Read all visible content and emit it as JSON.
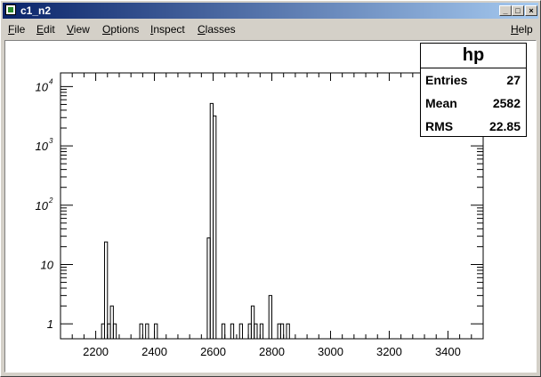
{
  "window": {
    "title": "c1_n2",
    "buttons": [
      "_",
      "□",
      "×"
    ]
  },
  "menubar": {
    "items": [
      {
        "label": "File",
        "mnemonic": "F",
        "rest": "ile"
      },
      {
        "label": "Edit",
        "mnemonic": "E",
        "rest": "dit"
      },
      {
        "label": "View",
        "mnemonic": "V",
        "rest": "iew"
      },
      {
        "label": "Options",
        "mnemonic": "O",
        "rest": "ptions"
      },
      {
        "label": "Inspect",
        "mnemonic": "I",
        "rest": "nspect"
      },
      {
        "label": "Classes",
        "mnemonic": "C",
        "rest": "lasses"
      }
    ],
    "help": {
      "label": "Help",
      "mnemonic": "H",
      "rest": "elp"
    }
  },
  "statbox": {
    "name": "hp",
    "entries_label": "Entries",
    "entries_value": "27",
    "mean_label": "Mean",
    "mean_value": "2582",
    "rms_label": "RMS",
    "rms_value": "22.85"
  },
  "chart_data": {
    "type": "bar",
    "title": "",
    "xlabel": "",
    "ylabel": "",
    "log_y": true,
    "xlim": [
      2080,
      3520
    ],
    "ylim": [
      0.56,
      17000
    ],
    "x_ticks": [
      2200,
      2400,
      2600,
      2800,
      3000,
      3200,
      3400
    ],
    "y_ticks": [
      {
        "value": 1,
        "label": "1"
      },
      {
        "value": 10,
        "label": "10"
      },
      {
        "value": 100,
        "label": "10",
        "exp": "2"
      },
      {
        "value": 1000,
        "label": "10",
        "exp": "3"
      },
      {
        "value": 10000,
        "label": "10",
        "exp": "4"
      }
    ],
    "bin_width": 10,
    "bins": [
      {
        "x": 2220,
        "value": 1
      },
      {
        "x": 2230,
        "value": 24
      },
      {
        "x": 2240,
        "value": 1
      },
      {
        "x": 2250,
        "value": 2
      },
      {
        "x": 2260,
        "value": 1
      },
      {
        "x": 2350,
        "value": 1
      },
      {
        "x": 2370,
        "value": 1
      },
      {
        "x": 2400,
        "value": 1
      },
      {
        "x": 2580,
        "value": 28
      },
      {
        "x": 2590,
        "value": 5200
      },
      {
        "x": 2600,
        "value": 3200
      },
      {
        "x": 2630,
        "value": 1
      },
      {
        "x": 2660,
        "value": 1
      },
      {
        "x": 2690,
        "value": 1
      },
      {
        "x": 2720,
        "value": 1
      },
      {
        "x": 2730,
        "value": 2
      },
      {
        "x": 2740,
        "value": 1
      },
      {
        "x": 2760,
        "value": 1
      },
      {
        "x": 2790,
        "value": 3
      },
      {
        "x": 2820,
        "value": 1
      },
      {
        "x": 2830,
        "value": 1
      },
      {
        "x": 2850,
        "value": 1
      }
    ]
  }
}
